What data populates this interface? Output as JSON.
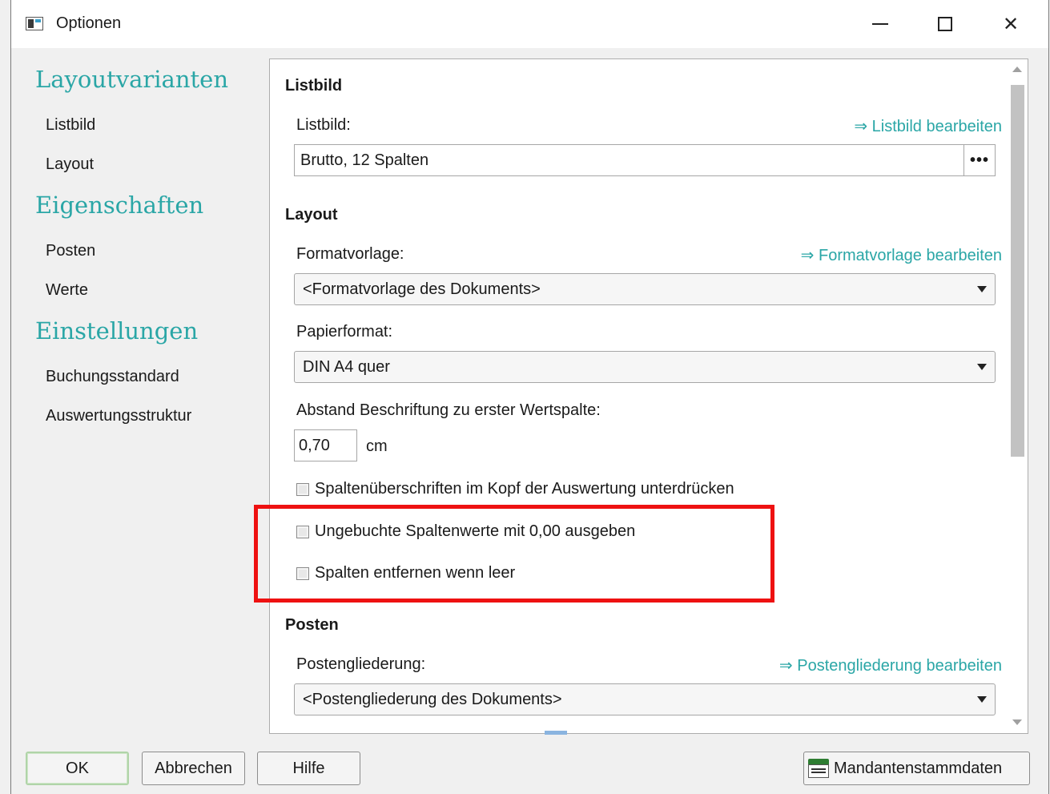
{
  "window": {
    "title": "Optionen",
    "controls": {
      "minimize": "—",
      "maximize": "☐",
      "close": "✕"
    }
  },
  "nav": {
    "sections": [
      {
        "heading": "Layoutvarianten",
        "items": [
          "Listbild",
          "Layout"
        ]
      },
      {
        "heading": "Eigenschaften",
        "items": [
          "Posten",
          "Werte"
        ]
      },
      {
        "heading": "Einstellungen",
        "items": [
          "Buchungsstandard",
          "Auswertungsstruktur"
        ]
      }
    ]
  },
  "listbild": {
    "section_title": "Listbild",
    "label": "Listbild:",
    "edit_link": "⇒ Listbild bearbeiten",
    "value": "Brutto, 12 Spalten",
    "browse_label": "•••"
  },
  "layout": {
    "section_title": "Layout",
    "formatvorlage_label": "Formatvorlage:",
    "formatvorlage_link": "⇒ Formatvorlage bearbeiten",
    "formatvorlage_value": "<Formatvorlage des Dokuments>",
    "papierformat_label": "Papierformat:",
    "papierformat_value": "DIN A4 quer",
    "abstand_label": "Abstand Beschriftung zu erster Wertspalte:",
    "abstand_value": "0,70",
    "abstand_unit": "cm",
    "checkboxes": [
      {
        "label": "Spaltenüberschriften im Kopf der Auswertung unterdrücken",
        "checked": false
      },
      {
        "label": "Ungebuchte Spaltenwerte mit 0,00 ausgeben",
        "checked": false
      },
      {
        "label": "Spalten entfernen wenn leer",
        "checked": false
      }
    ]
  },
  "posten": {
    "section_title": "Posten",
    "label": "Postengliederung:",
    "edit_link": "⇒ Postengliederung bearbeiten",
    "value": "<Postengliederung des Dokuments>"
  },
  "buttons": {
    "ok": "OK",
    "cancel": "Abbrechen",
    "help": "Hilfe",
    "master": "Mandantenstammdaten"
  },
  "colors": {
    "accent": "#2aa6a6",
    "highlight": "#ee1111"
  }
}
